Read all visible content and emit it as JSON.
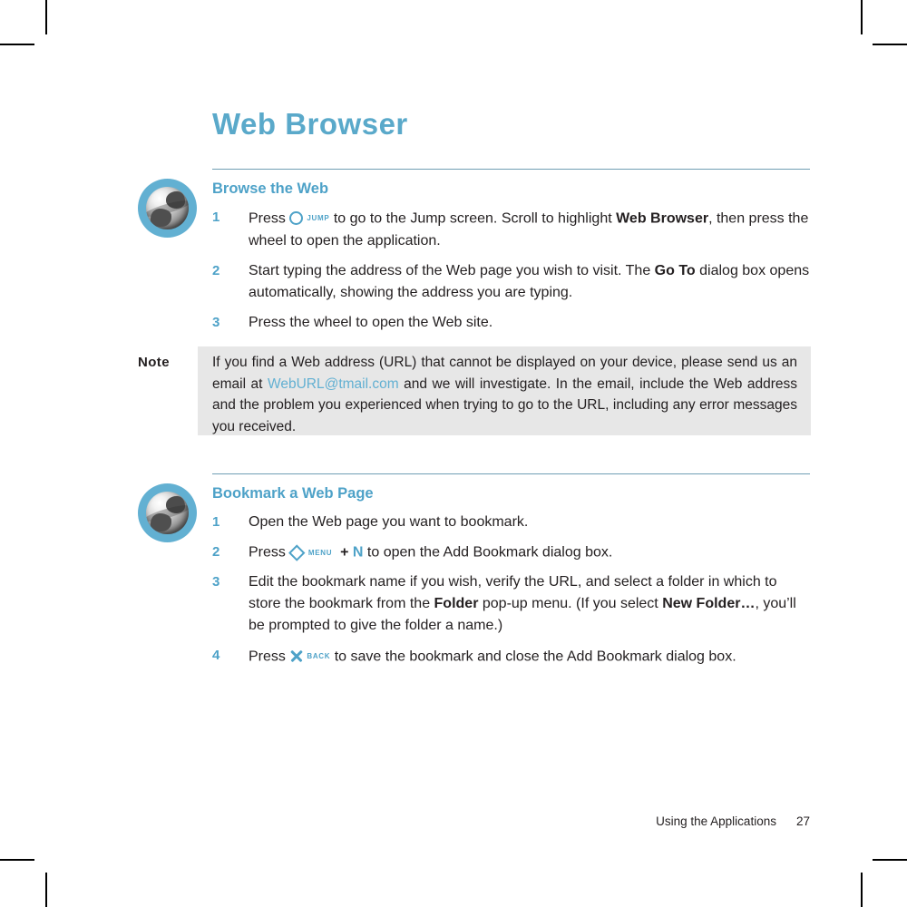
{
  "page": {
    "chapter_title": "Web Browser",
    "footer_section": "Using the Applications",
    "footer_page_number": "27",
    "accent_color": "#4ea2c8",
    "title_color": "#5aa9ca",
    "note_background": "#e7e7e7",
    "link_color": "#62b0d2"
  },
  "sections": [
    {
      "icon": "globe-icon",
      "heading": "Browse the Web",
      "steps": [
        {
          "number": "1",
          "text_before_key": "Press ",
          "key_glyph": "circle-key",
          "key_label": "JUMP",
          "text_after_key": " to go to the Jump screen. Scroll to highlight ",
          "bold_term": "Web Browser",
          "text_tail": ", then  press the wheel to open the application."
        },
        {
          "number": "2",
          "text_before_key": "Start typing the address of the Web page you wish to visit. The ",
          "bold_term": "Go To",
          "text_tail": " dialog box opens automatically, showing the address you are typing."
        },
        {
          "number": "3",
          "text_before_key": "Press the wheel to open the Web site."
        }
      ]
    },
    {
      "icon": "globe-icon",
      "heading": "Bookmark a Web Page",
      "steps": [
        {
          "number": "1",
          "text_before_key": "Open the Web page you want to bookmark."
        },
        {
          "number": "2",
          "text_before_key": "Press ",
          "key_glyph": "diamond-key",
          "key_label": "MENU",
          "combo_plus": "+",
          "combo_letter": "N",
          "text_after_key": " to open the Add Bookmark dialog box."
        },
        {
          "number": "3",
          "text_before_key": "Edit the bookmark name if you wish, verify the URL, and select a folder in which to store the bookmark from the ",
          "bold_term": "Folder",
          "text_mid": " pop-up menu. (If you select ",
          "bold_term2": "New Folder…",
          "text_tail": ", you’ll be prompted to give the folder a name.)"
        },
        {
          "number": "4",
          "text_before_key": "Press ",
          "key_glyph": "x-key",
          "key_label": "BACK",
          "text_after_key": " to save the bookmark and close the Add Bookmark dialog box."
        }
      ]
    }
  ],
  "note": {
    "label": "Note",
    "text_part1": "If you find a Web address (URL) that cannot be displayed on your device, please send us an email at ",
    "email": "WebURL@tmail.com",
    "text_part2": " and we will investigate. In the email, include the Web address and the problem you experienced when trying to go to the URL, including any error messages you received."
  }
}
